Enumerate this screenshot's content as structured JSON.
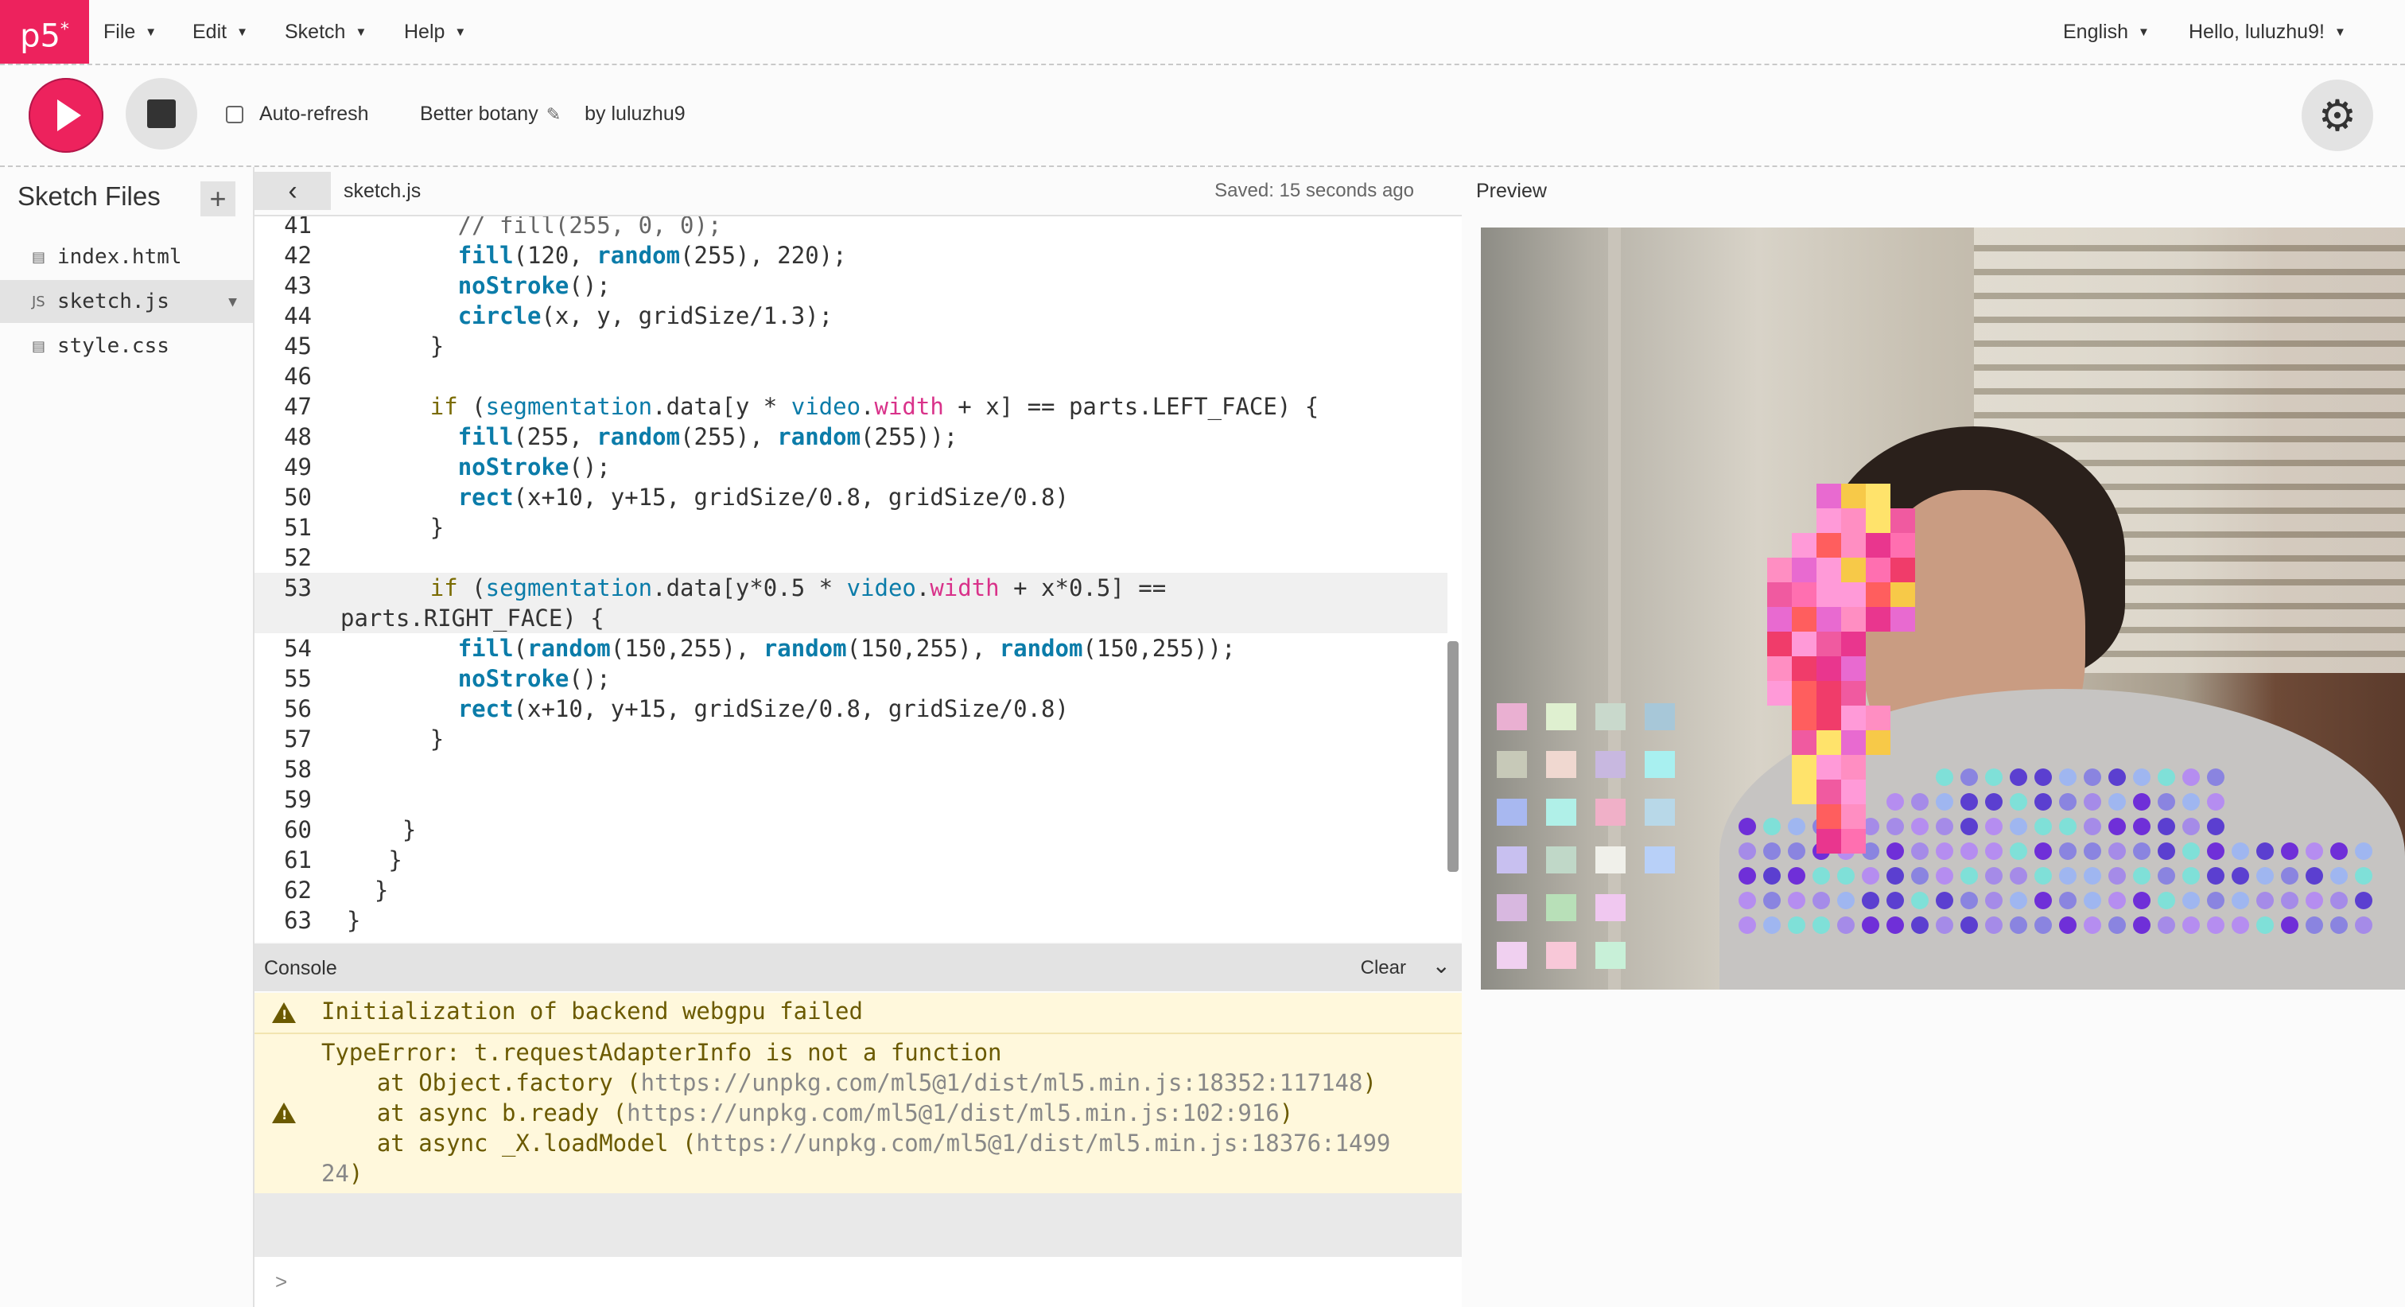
{
  "app": {
    "logo": "p5",
    "logo_sup": "*"
  },
  "menu": {
    "items": [
      "File",
      "Edit",
      "Sketch",
      "Help"
    ],
    "language": "English",
    "greeting": "Hello, luluzhu9!"
  },
  "toolbar": {
    "auto_refresh_label": "Auto-refresh",
    "auto_refresh_checked": false,
    "sketch_name": "Better botany",
    "by_label": "by luluzhu9"
  },
  "sidebar": {
    "title": "Sketch Files",
    "files": [
      {
        "name": "index.html",
        "icon": "file-icon"
      },
      {
        "name": "sketch.js",
        "icon": "js-file-icon",
        "badge": "JS",
        "active": true
      },
      {
        "name": "style.css",
        "icon": "file-icon"
      }
    ]
  },
  "editor": {
    "tab": "sketch.js",
    "saved": "Saved: 15 seconds ago",
    "lines": [
      {
        "n": "41",
        "code": "        // fill(255, 0, 0);"
      },
      {
        "n": "42",
        "code": "        fill(120, random(255), 220);"
      },
      {
        "n": "43",
        "code": "        noStroke();"
      },
      {
        "n": "44",
        "code": "        circle(x, y, gridSize/1.3);"
      },
      {
        "n": "45",
        "code": "      }"
      },
      {
        "n": "46",
        "code": ""
      },
      {
        "n": "47",
        "code": "      if (segmentation.data[y * video.width + x] == parts.LEFT_FACE) {"
      },
      {
        "n": "48",
        "code": "        fill(255, random(255), random(255));"
      },
      {
        "n": "49",
        "code": "        noStroke();"
      },
      {
        "n": "50",
        "code": "        rect(x+10, y+15, gridSize/0.8, gridSize/0.8)"
      },
      {
        "n": "51",
        "code": "      }"
      },
      {
        "n": "52",
        "code": ""
      },
      {
        "n": "53",
        "code": "      if (segmentation.data[y*0.5 * video.width + x*0.5] =="
      },
      {
        "n": "",
        "code": "parts.RIGHT_FACE) {"
      },
      {
        "n": "54",
        "code": "        fill(random(150,255), random(150,255), random(150,255));"
      },
      {
        "n": "55",
        "code": "        noStroke();"
      },
      {
        "n": "56",
        "code": "        rect(x+10, y+15, gridSize/0.8, gridSize/0.8)"
      },
      {
        "n": "57",
        "code": "      }"
      },
      {
        "n": "58",
        "code": ""
      },
      {
        "n": "59",
        "code": ""
      },
      {
        "n": "60",
        "code": "    }"
      },
      {
        "n": "61",
        "code": "   }"
      },
      {
        "n": "62",
        "code": "  }"
      },
      {
        "n": "63",
        "code": "}"
      }
    ]
  },
  "console": {
    "title": "Console",
    "clear_label": "Clear",
    "warning_1": "Initialization of backend webgpu failed",
    "error_lines": [
      {
        "text": "TypeError: t.requestAdapterInfo is not a function",
        "url": "",
        "suffix": ""
      },
      {
        "text": "    at Object.factory (",
        "url": "https://unpkg.com/ml5@1/dist/ml5.min.js:18352:117148",
        "suffix": ")"
      },
      {
        "text": "    at async b.ready (",
        "url": "https://unpkg.com/ml5@1/dist/ml5.min.js:102:916",
        "suffix": ")"
      },
      {
        "text": "    at async _X.loadModel (",
        "url": "https://unpkg.com/ml5@1/dist/ml5.min.js:18376:1499",
        "suffix": ""
      },
      {
        "text": "",
        "url": "24",
        "suffix": ")"
      }
    ],
    "prompt": ">"
  },
  "preview": {
    "label": "Preview"
  },
  "colors": {
    "accent": "#ed225d",
    "warning_text": "#6b5a00",
    "warning_bg": "#fff8dc",
    "keyword": "#0b7ca9"
  }
}
